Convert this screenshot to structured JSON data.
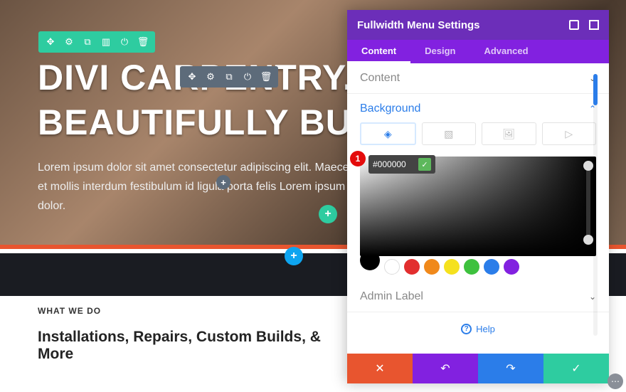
{
  "hero": {
    "title_line1": "DIVI CARPENTRY.",
    "title_line2": "BEAUTIFULLY BUILT.",
    "body": "Lorem ipsum dolor sit amet consectetur adipiscing elit. Maecenas et mollis interdum festibulum id ligula porta felis Lorem ipsum dolor."
  },
  "card": {
    "eyebrow": "WHAT WE DO",
    "headline": "Installations, Repairs, Custom Builds, & More"
  },
  "panel": {
    "title": "Fullwidth Menu Settings",
    "tabs": {
      "content": "Content",
      "design": "Design",
      "advanced": "Advanced"
    },
    "sections": {
      "content": "Content",
      "background": "Background",
      "admin": "Admin Label"
    },
    "hex": "#000000",
    "swatches": [
      "#000000",
      "#ffffff",
      "#e22e2e",
      "#f0891b",
      "#f5e11e",
      "#3ec13e",
      "#2b7de9",
      "#8221e0"
    ],
    "help": "Help"
  },
  "annot": "1"
}
